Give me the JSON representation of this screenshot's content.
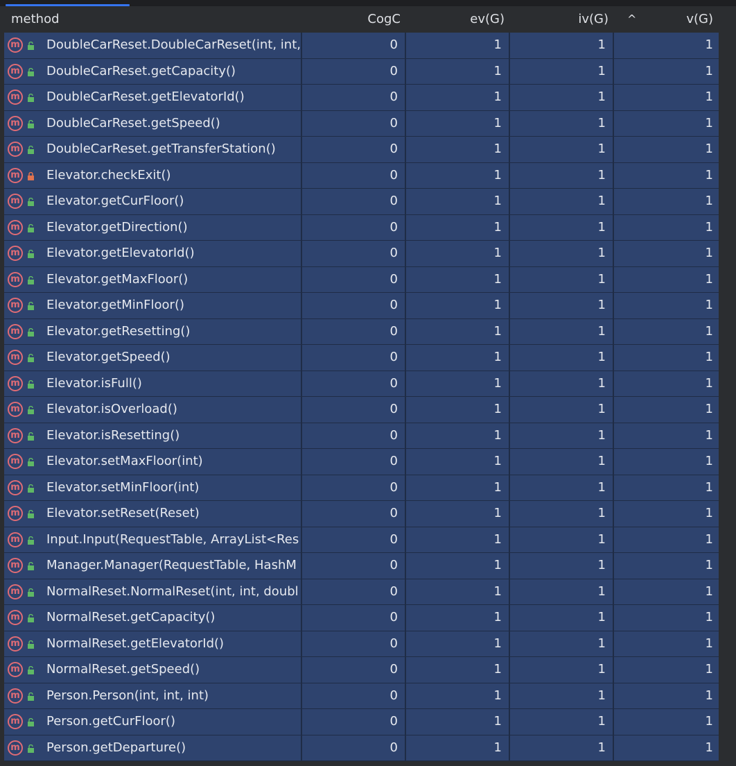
{
  "header": {
    "method": "method",
    "cogc": "CogC",
    "ev": "ev(G)",
    "iv": "iv(G)",
    "sort_indicator": "^",
    "v": "v(G)"
  },
  "colors": {
    "row_bg": "#2e436e",
    "method_icon": "#e06c75",
    "public_lock": "#5fb865",
    "private_lock": "#e0734f"
  },
  "rows": [
    {
      "method": "DoubleCarReset.DoubleCarReset(int, int,",
      "cogc": "0",
      "ev": "1",
      "iv": "1",
      "v": "1",
      "visibility": "public"
    },
    {
      "method": "DoubleCarReset.getCapacity()",
      "cogc": "0",
      "ev": "1",
      "iv": "1",
      "v": "1",
      "visibility": "public"
    },
    {
      "method": "DoubleCarReset.getElevatorId()",
      "cogc": "0",
      "ev": "1",
      "iv": "1",
      "v": "1",
      "visibility": "public"
    },
    {
      "method": "DoubleCarReset.getSpeed()",
      "cogc": "0",
      "ev": "1",
      "iv": "1",
      "v": "1",
      "visibility": "public"
    },
    {
      "method": "DoubleCarReset.getTransferStation()",
      "cogc": "0",
      "ev": "1",
      "iv": "1",
      "v": "1",
      "visibility": "public"
    },
    {
      "method": "Elevator.checkExit()",
      "cogc": "0",
      "ev": "1",
      "iv": "1",
      "v": "1",
      "visibility": "private"
    },
    {
      "method": "Elevator.getCurFloor()",
      "cogc": "0",
      "ev": "1",
      "iv": "1",
      "v": "1",
      "visibility": "public"
    },
    {
      "method": "Elevator.getDirection()",
      "cogc": "0",
      "ev": "1",
      "iv": "1",
      "v": "1",
      "visibility": "public"
    },
    {
      "method": "Elevator.getElevatorId()",
      "cogc": "0",
      "ev": "1",
      "iv": "1",
      "v": "1",
      "visibility": "public"
    },
    {
      "method": "Elevator.getMaxFloor()",
      "cogc": "0",
      "ev": "1",
      "iv": "1",
      "v": "1",
      "visibility": "public"
    },
    {
      "method": "Elevator.getMinFloor()",
      "cogc": "0",
      "ev": "1",
      "iv": "1",
      "v": "1",
      "visibility": "public"
    },
    {
      "method": "Elevator.getResetting()",
      "cogc": "0",
      "ev": "1",
      "iv": "1",
      "v": "1",
      "visibility": "public"
    },
    {
      "method": "Elevator.getSpeed()",
      "cogc": "0",
      "ev": "1",
      "iv": "1",
      "v": "1",
      "visibility": "public"
    },
    {
      "method": "Elevator.isFull()",
      "cogc": "0",
      "ev": "1",
      "iv": "1",
      "v": "1",
      "visibility": "public"
    },
    {
      "method": "Elevator.isOverload()",
      "cogc": "0",
      "ev": "1",
      "iv": "1",
      "v": "1",
      "visibility": "public"
    },
    {
      "method": "Elevator.isResetting()",
      "cogc": "0",
      "ev": "1",
      "iv": "1",
      "v": "1",
      "visibility": "public"
    },
    {
      "method": "Elevator.setMaxFloor(int)",
      "cogc": "0",
      "ev": "1",
      "iv": "1",
      "v": "1",
      "visibility": "public"
    },
    {
      "method": "Elevator.setMinFloor(int)",
      "cogc": "0",
      "ev": "1",
      "iv": "1",
      "v": "1",
      "visibility": "public"
    },
    {
      "method": "Elevator.setReset(Reset)",
      "cogc": "0",
      "ev": "1",
      "iv": "1",
      "v": "1",
      "visibility": "public"
    },
    {
      "method": "Input.Input(RequestTable, ArrayList<Res",
      "cogc": "0",
      "ev": "1",
      "iv": "1",
      "v": "1",
      "visibility": "public"
    },
    {
      "method": "Manager.Manager(RequestTable, HashM",
      "cogc": "0",
      "ev": "1",
      "iv": "1",
      "v": "1",
      "visibility": "public"
    },
    {
      "method": "NormalReset.NormalReset(int, int, doubl",
      "cogc": "0",
      "ev": "1",
      "iv": "1",
      "v": "1",
      "visibility": "public"
    },
    {
      "method": "NormalReset.getCapacity()",
      "cogc": "0",
      "ev": "1",
      "iv": "1",
      "v": "1",
      "visibility": "public"
    },
    {
      "method": "NormalReset.getElevatorId()",
      "cogc": "0",
      "ev": "1",
      "iv": "1",
      "v": "1",
      "visibility": "public"
    },
    {
      "method": "NormalReset.getSpeed()",
      "cogc": "0",
      "ev": "1",
      "iv": "1",
      "v": "1",
      "visibility": "public"
    },
    {
      "method": "Person.Person(int, int, int)",
      "cogc": "0",
      "ev": "1",
      "iv": "1",
      "v": "1",
      "visibility": "public"
    },
    {
      "method": "Person.getCurFloor()",
      "cogc": "0",
      "ev": "1",
      "iv": "1",
      "v": "1",
      "visibility": "public"
    },
    {
      "method": "Person.getDeparture()",
      "cogc": "0",
      "ev": "1",
      "iv": "1",
      "v": "1",
      "visibility": "public"
    }
  ]
}
